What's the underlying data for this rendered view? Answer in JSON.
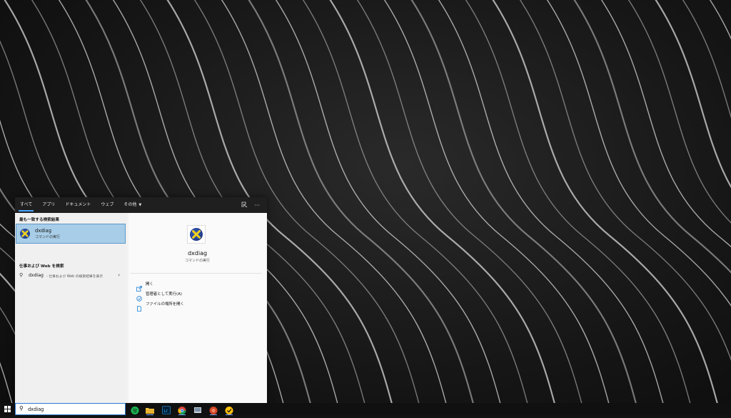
{
  "tabs": [
    {
      "label": "すべて",
      "active": true
    },
    {
      "label": "アプリ",
      "active": false
    },
    {
      "label": "ドキュメント",
      "active": false
    },
    {
      "label": "ウェブ",
      "active": false
    },
    {
      "label": "その他",
      "active": false
    }
  ],
  "left": {
    "best_match_header": "最も一致する検索結果",
    "best_match": {
      "title": "dxdiag",
      "subtitle": "コマンドの実行"
    },
    "web_header": "仕事および Web を検索",
    "web_result": {
      "query": "dxdiag",
      "description": "- 仕事および Web の検索結果を表示"
    }
  },
  "right": {
    "title": "dxdiag",
    "subtitle": "コマンドの実行",
    "actions": [
      {
        "label": "開く",
        "icon": "open-icon"
      },
      {
        "label": "管理者として実行(A)",
        "icon": "admin-shield-icon"
      },
      {
        "label": "ファイルの場所を開く",
        "icon": "file-location-icon"
      }
    ]
  },
  "taskbar": {
    "search_value": "dxdiag",
    "apps": [
      "spotify-icon",
      "file-explorer-icon",
      "lightroom-icon",
      "chrome-icon",
      "app-icon",
      "powerpoint-icon",
      "norton-icon"
    ]
  },
  "colors": {
    "selection_bg": "#a8cde8",
    "selection_border": "#5a97c8",
    "accent": "#4aa3ff"
  }
}
